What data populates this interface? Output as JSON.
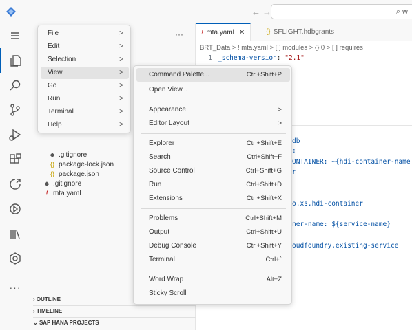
{
  "titlebar": {
    "logo_icon": "vscode-logo-icon",
    "back_arrow": "←",
    "forward_arrow": "→",
    "search_glyph": "⌕",
    "search_text": "w"
  },
  "activitybar": {
    "icons": [
      "menu-icon",
      "explorer-icon",
      "search-icon",
      "source-control-icon",
      "run-debug-icon",
      "extensions-icon",
      "remote-icon",
      "deploy-icon",
      "library-icon",
      "extension-pack-icon"
    ],
    "more": "···"
  },
  "sidebar": {
    "more": "···",
    "tree": [
      {
        "icon": "◆",
        "icon_color": "#555555",
        "label": ".gitignore",
        "indent": 26
      },
      {
        "icon": "{}",
        "icon_color": "#c6a100",
        "label": "package-lock.json",
        "indent": 26
      },
      {
        "icon": "{}",
        "icon_color": "#c6a100",
        "label": "package.json",
        "indent": 26
      },
      {
        "icon": "◆",
        "icon_color": "#555555",
        "label": ".gitignore",
        "indent": 18
      },
      {
        "icon": "!",
        "icon_color": "#c62828",
        "label": "mta.yaml",
        "indent": 18
      }
    ],
    "sections": {
      "outline": "OUTLINE",
      "timeline": "TIMELINE",
      "hana": "SAP HANA PROJECTS"
    }
  },
  "editor": {
    "tabs": [
      {
        "icon": "!",
        "label": "mta.yaml",
        "close": "✕"
      },
      {
        "icon": "{}",
        "label": "SFLIGHT.hdbgrants"
      }
    ],
    "breadcrumb": "BRT_Data > ! mta.yaml > [ ] modules > {} 0 > [ ] requires",
    "line1": {
      "num": "1",
      "key": "_schema-version",
      "sep": ": ",
      "value": "\"2.1\""
    },
    "code_fragments": [
      "db",
      ":",
      "ONTAINER: ~{hdi-container-name",
      "r",
      "",
      "o.xs.hdi-container",
      "",
      "ner-name: ${service-name}",
      "",
      "oudfoundry.existing-service"
    ]
  },
  "menubar": {
    "items": [
      {
        "label": "File",
        "chevron": ">"
      },
      {
        "label": "Edit",
        "chevron": ">"
      },
      {
        "label": "Selection",
        "chevron": ">"
      },
      {
        "label": "View",
        "chevron": ">",
        "selected": true
      },
      {
        "label": "Go",
        "chevron": ">"
      },
      {
        "label": "Run",
        "chevron": ">"
      },
      {
        "label": "Terminal",
        "chevron": ">"
      },
      {
        "label": "Help",
        "chevron": ">"
      }
    ]
  },
  "view_menu": {
    "groups": [
      [
        {
          "label": "Command Palette...",
          "shortcut": "Ctrl+Shift+P",
          "selected": true
        },
        {
          "label": "Open View...",
          "shortcut": ""
        }
      ],
      [
        {
          "label": "Appearance",
          "shortcut": ">"
        },
        {
          "label": "Editor Layout",
          "shortcut": ">"
        }
      ],
      [
        {
          "label": "Explorer",
          "shortcut": "Ctrl+Shift+E"
        },
        {
          "label": "Search",
          "shortcut": "Ctrl+Shift+F"
        },
        {
          "label": "Source Control",
          "shortcut": "Ctrl+Shift+G"
        },
        {
          "label": "Run",
          "shortcut": "Ctrl+Shift+D"
        },
        {
          "label": "Extensions",
          "shortcut": "Ctrl+Shift+X"
        }
      ],
      [
        {
          "label": "Problems",
          "shortcut": "Ctrl+Shift+M"
        },
        {
          "label": "Output",
          "shortcut": "Ctrl+Shift+U"
        },
        {
          "label": "Debug Console",
          "shortcut": "Ctrl+Shift+Y"
        },
        {
          "label": "Terminal",
          "shortcut": "Ctrl+`"
        }
      ],
      [
        {
          "label": "Word Wrap",
          "shortcut": "Alt+Z"
        },
        {
          "label": "Sticky Scroll",
          "shortcut": ""
        }
      ]
    ]
  },
  "colors": {
    "accent": "#005fb8",
    "yaml_key": "#0451a5",
    "yaml_string": "#a31515",
    "json_icon": "#c6a100",
    "yaml_icon": "#c62828"
  }
}
